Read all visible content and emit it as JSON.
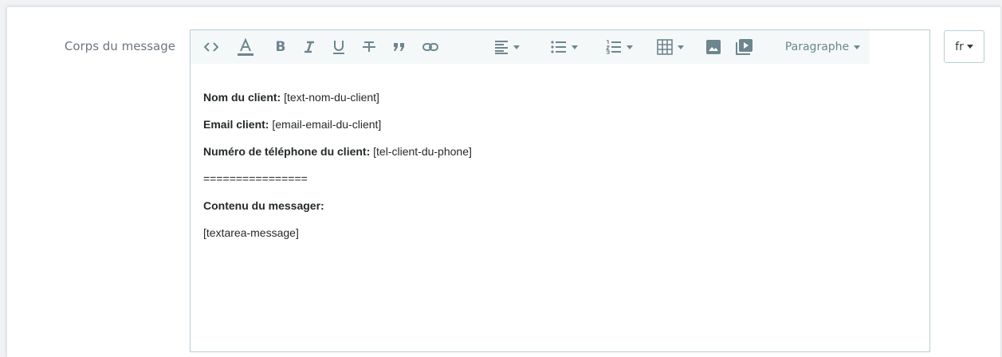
{
  "field": {
    "label": "Corps du message"
  },
  "toolbar": {
    "icons": [
      "code-icon",
      "text-color-icon",
      "bold-icon",
      "italic-icon",
      "underline-icon",
      "strikethrough-icon",
      "blockquote-icon",
      "link-icon",
      "align-icon",
      "bullet-list-icon",
      "numbered-list-icon",
      "table-icon",
      "image-icon",
      "media-icon"
    ],
    "block_format": "Paragraphe"
  },
  "content": {
    "lines": [
      {
        "bold": "Nom du client:",
        "value": " [text-nom-du-client]"
      },
      {
        "bold": "Email client:",
        "value": " [email-email-du-client]"
      },
      {
        "bold": "Numéro de téléphone du client:",
        "value": " [tel-client-du-phone]"
      },
      {
        "bold": "",
        "value": "================"
      },
      {
        "bold": "Contenu du messager:",
        "value": ""
      },
      {
        "bold": "",
        "value": "[textarea-message]"
      }
    ]
  },
  "language": {
    "selected": "fr"
  },
  "colors": {
    "icon": "#6c868e",
    "border": "#bbcdd2",
    "toolbar_bg": "#f5f8f9",
    "label": "#6c757d"
  }
}
